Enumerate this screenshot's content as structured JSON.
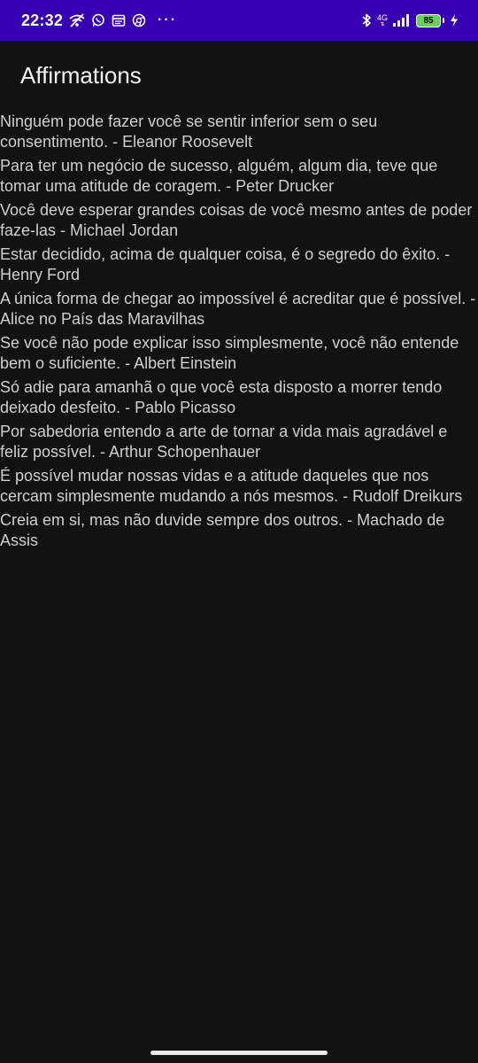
{
  "status_bar": {
    "time": "22:32",
    "network": "4G",
    "battery": "85",
    "more": "···",
    "icons": [
      "wifi-off-icon",
      "whatsapp-icon",
      "calendar-icon",
      "chrome-icon",
      "bluetooth-icon",
      "signal-icon",
      "battery-icon",
      "charging-icon"
    ],
    "colors": {
      "background": "#3700b3",
      "battery_fill": "#63d35b"
    }
  },
  "app": {
    "title": "Affirmations",
    "background": "#121212"
  },
  "quotes": [
    "Ninguém pode fazer você se sentir inferior sem o seu consentimento. - Eleanor Roosevelt",
    "Para ter um negócio de sucesso, alguém, algum dia, teve que tomar uma atitude de coragem. - Peter Drucker",
    "Você deve esperar grandes coisas de você mesmo antes de poder faze-las - Michael Jordan",
    "Estar decidido, acima de qualquer coisa, é o segredo do êxito. - Henry Ford",
    "A única forma de chegar ao impossível é acreditar que é possível. - Alice no País das Maravilhas",
    "Se você não pode explicar isso simplesmente, você não entende bem o suficiente. - Albert Einstein",
    "Só adie para amanhã o que você esta disposto a morrer tendo deixado desfeito. - Pablo Picasso",
    "Por sabedoria entendo a arte de tornar a vida mais agradável e feliz possível. - Arthur Schopenhauer",
    "É possível mudar nossas vidas e a atitude daqueles que nos cercam simplesmente mudando a nós mesmos. - Rudolf Dreikurs",
    "Creia em si, mas não duvide sempre dos outros. - Machado de Assis"
  ]
}
